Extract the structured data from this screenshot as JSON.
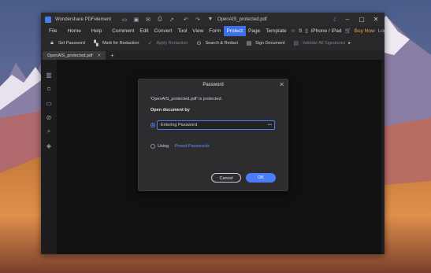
{
  "app": {
    "title": "Wondershare PDFelement",
    "doc_title": "OpenAIS_protected.pdf"
  },
  "titlebar_icons": [
    "folder-icon",
    "save-icon",
    "mail-icon",
    "print-icon",
    "share-icon",
    "undo-icon",
    "redo-icon",
    "pdf-file-icon"
  ],
  "menu": {
    "items": [
      "File",
      "Home",
      "Help",
      "Comment",
      "Edit",
      "Convert",
      "Tool",
      "View",
      "Form",
      "Protect",
      "Page",
      "Template"
    ],
    "active": "Protect",
    "device": "iPhone / iPad",
    "buy_now": "Buy Now",
    "login": "Log In",
    "search_truncated": "S"
  },
  "toolbar": {
    "set_password": "Set Password",
    "mark_redaction": "Mark for Redaction",
    "apply_redaction": "Apply Redaction",
    "search_redact": "Search & Redact",
    "sign_document": "Sign Document",
    "validate_signatures": "Validate All Signatures"
  },
  "tab": {
    "name": "OpenAIS_protected.pdf",
    "add": "+"
  },
  "dialog": {
    "title": "Password",
    "message": "'OpenAIS_protected.pdf' is protected.",
    "subheading": "Open document by",
    "password_placeholder": "Entering Password",
    "using_label": "Using",
    "preset_link": "Preset Passwords",
    "cancel": "Cancel",
    "ok": "OK",
    "accent": "#4a7cf6"
  }
}
